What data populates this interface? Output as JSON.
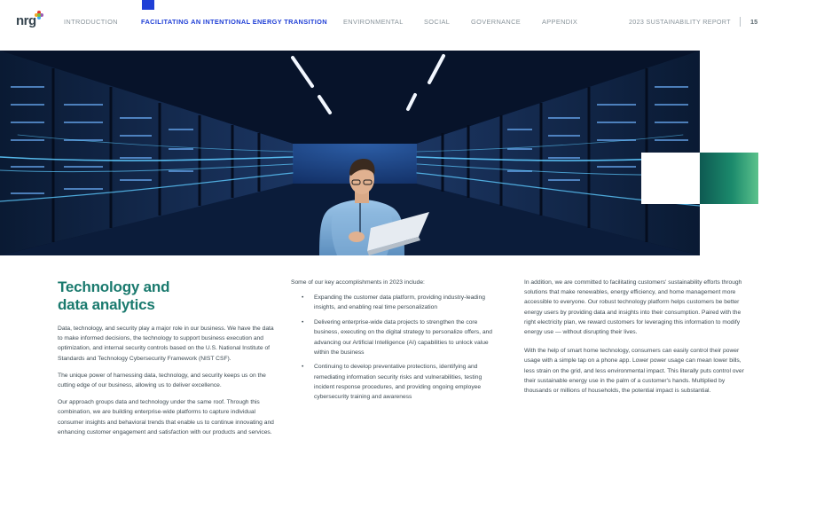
{
  "header": {
    "logo_text": "nrg",
    "logo_dot_colors": [
      "#e8362d",
      "#f5a623",
      "#3fa9f5",
      "#7ac143",
      "#9b59b6"
    ],
    "nav": [
      {
        "label": "INTRODUCTION",
        "active": false
      },
      {
        "label": "FACILITATING AN INTENTIONAL ENERGY TRANSITION",
        "active": true
      },
      {
        "label": "ENVIRONMENTAL",
        "active": false
      },
      {
        "label": "SOCIAL",
        "active": false
      },
      {
        "label": "GOVERNANCE",
        "active": false
      },
      {
        "label": "APPENDIX",
        "active": false
      }
    ],
    "report_title": "2023 SUSTAINABILITY REPORT",
    "page_number": "15",
    "active_color": "#1f3fd6"
  },
  "hero": {
    "subject": "man with laptop in data center server aisle",
    "accent_green": "#1b8a6c"
  },
  "column1": {
    "title_line1": "Technology and",
    "title_line2": "data analytics",
    "paragraphs": [
      "Data, technology, and security play a major role in our business. We have the data to make informed decisions, the technology to support business execution and optimization, and internal security controls based on the U.S. National Institute of Standards and Technology Cybersecurity Framework (NIST CSF).",
      "The unique power of harnessing data, technology, and security keeps us on the cutting edge of our business, allowing us to deliver excellence.",
      "Our approach groups data and technology under the same roof. Through this combination, we are building enterprise-wide platforms to capture individual consumer insights and behavioral trends that enable us to continue innovating and enhancing customer engagement and satisfaction with our products and services."
    ]
  },
  "column2": {
    "intro": "Some of our key accomplishments in 2023 include:",
    "bullets": [
      "Expanding the customer data platform, providing industry-leading insights, and enabling real time personalization",
      "Delivering enterprise-wide data projects to strengthen the core business, executing on the digital strategy to personalize offers, and advancing our Artificial Intelligence (AI) capabilities to unlock value within the business",
      "Continuing to develop preventative protections, identifying and remediating information security risks and vulnerabilities, testing incident response procedures, and providing ongoing employee cybersecurity training and awareness"
    ]
  },
  "column3": {
    "paragraphs": [
      "In addition, we are committed to facilitating customers' sustainability efforts through solutions that make renewables, energy efficiency, and home management more accessible to everyone. Our robust technology platform helps customers be better energy users by providing data and insights into their consumption. Paired with the right electricity plan, we reward customers for leveraging this information to modify energy use — without disrupting their lives.",
      "With the help of smart home technology, consumers can easily control their power usage with a simple tap on a phone app. Lower power usage can mean lower bills, less strain on the grid, and less environmental impact. This literally puts control over their sustainable energy use in the palm of a customer's hands. Multiplied by thousands or millions of households, the potential impact is substantial."
    ]
  }
}
